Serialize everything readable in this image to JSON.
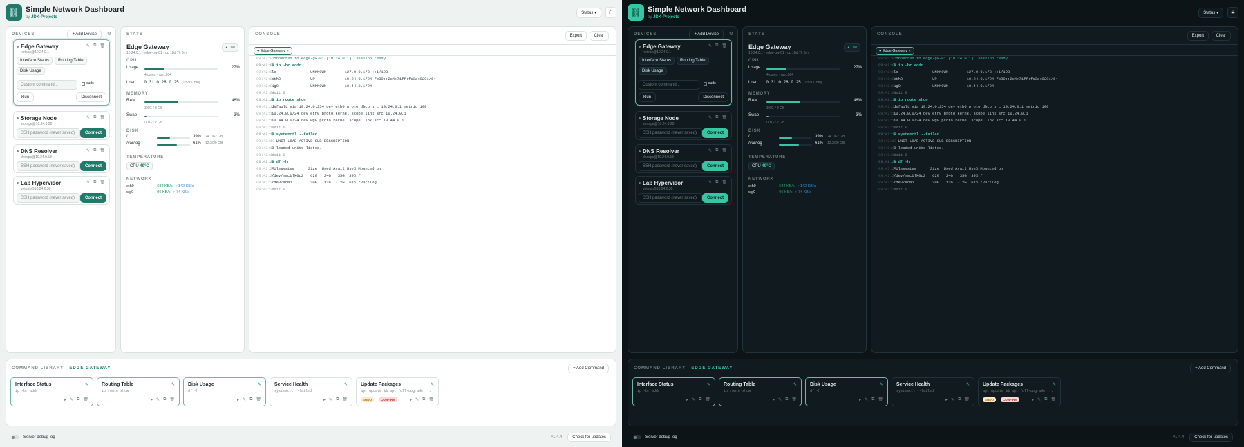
{
  "app": {
    "title": "Simple Network Dashboard",
    "by": "by",
    "author": "JDK-Projects",
    "status_label": "Status",
    "status_chevron": "▾",
    "theme_icons": [
      "moon-icon",
      "sun-icon"
    ]
  },
  "devices": {
    "title": "DEVICES",
    "add_label": "+ Add Device",
    "items": [
      {
        "name": "Edge Gateway",
        "sub": "netops@10.24.0.1",
        "selected": true
      },
      {
        "name": "Storage Node",
        "sub": "storage@10.24.0.20",
        "password_ph": "SSH password (never saved)",
        "connect": "Connect"
      },
      {
        "name": "DNS Resolver",
        "sub": "dnsops@10.24.0.53",
        "password_ph": "SSH password (never saved)",
        "connect": "Connect"
      },
      {
        "name": "Lab Hypervisor",
        "sub": "virtops@10.24.0.30",
        "password_ph": "SSH password (never saved)",
        "connect": "Connect"
      }
    ],
    "selected": {
      "quick": [
        "Interface Status",
        "Routing Table",
        "Disk Usage"
      ],
      "custom_ph": "Custom command...",
      "sudo": "sudo",
      "run": "Run",
      "disconnect": "Disconnect"
    }
  },
  "stats": {
    "title": "STATS",
    "device": "Edge Gateway",
    "live": "Live",
    "subline": "10.24.0.1 · edge-gw-01 · up 18d 7h 3m",
    "cpu_label": "CPU",
    "usage_label": "Usage",
    "usage": "27%",
    "usage_frac": 0.27,
    "cores": "4 cores · aarch64",
    "load_label": "Load",
    "load": "0.31  0.28  0.25",
    "load_note": "(1/5/15 min)",
    "mem_label": "MEMORY",
    "ram_label": "RAM",
    "ram": "46%",
    "ram_frac": 0.46,
    "ram_detail": "3.6G / 8 GB",
    "swap_label": "Swap",
    "swap": "3%",
    "swap_frac": 0.03,
    "swap_detail": "0.1G / 2 GB",
    "disk_label": "DISK",
    "disks": [
      {
        "mount": "/",
        "pct": "39%",
        "frac": 0.39,
        "size": "24.1/62 GB"
      },
      {
        "mount": "/var/log",
        "pct": "61%",
        "frac": 0.61,
        "size": "12.2/20 GB"
      }
    ],
    "temp_label": "TEMPERATURE",
    "cpu_temp_label": "CPU",
    "cpu_temp": "49°C",
    "net_label": "NETWORK",
    "nets": [
      {
        "iface": "eth0",
        "down": "↓ 684 KB/s",
        "up": "↑ 142 KB/s"
      },
      {
        "iface": "wg0",
        "down": "↓ 96 KB/s",
        "up": "↑ 74 KB/s"
      }
    ]
  },
  "console": {
    "title": "CONSOLE",
    "export": "Export",
    "clear": "Clear",
    "tab": "Edge Gateway",
    "lines": [
      {
        "ts": "09:42:01",
        "text": "Connected to edge-gw-01 [10.24.0.1], session ready",
        "kind": "ok"
      },
      {
        "ts": "09:42:08",
        "text": "$ ip -br addr",
        "kind": "cmd"
      },
      {
        "ts": "09:42:09",
        "text": "lo               UNKNOWN        127.0.0.1/8 ::1/128",
        "kind": ""
      },
      {
        "ts": "09:42:09",
        "text": "eth0             UP             10.24.0.1/24 fe80::2c4:71ff:fe3a:9201/64",
        "kind": ""
      },
      {
        "ts": "09:42:09",
        "text": "wg0              UNKNOWN        10.44.0.1/24",
        "kind": ""
      },
      {
        "ts": "09:42:09",
        "text": "exit 0",
        "kind": "dim"
      },
      {
        "ts": "09:42:12",
        "text": "$ ip route show",
        "kind": "cmd"
      },
      {
        "ts": "09:42:13",
        "text": "default via 10.24.0.254 dev eth0 proto dhcp src 10.24.0.1 metric 100",
        "kind": ""
      },
      {
        "ts": "09:42:13",
        "text": "10.24.0.0/24 dev eth0 proto kernel scope link src 10.24.0.1",
        "kind": ""
      },
      {
        "ts": "09:42:13",
        "text": "10.44.0.0/24 dev wg0 proto kernel scope link src 10.44.0.1",
        "kind": ""
      },
      {
        "ts": "09:42:13",
        "text": "exit 0",
        "kind": "dim"
      },
      {
        "ts": "09:42:18",
        "text": "$ systemctl --failed",
        "kind": "cmd"
      },
      {
        "ts": "09:42:19",
        "text": "  UNIT LOAD ACTIVE SUB DESCRIPTION",
        "kind": ""
      },
      {
        "ts": "09:42:19",
        "text": "0 loaded units listed.",
        "kind": ""
      },
      {
        "ts": "09:42:19",
        "text": "exit 0",
        "kind": "dim"
      },
      {
        "ts": "09:42:24",
        "text": "$ df -h",
        "kind": "cmd"
      },
      {
        "ts": "09:42:25",
        "text": "Filesystem      Size  Used Avail Use% Mounted on",
        "kind": ""
      },
      {
        "ts": "09:42:25",
        "text": "/dev/mmcblk0p2   62G   24G   35G  39% /",
        "kind": ""
      },
      {
        "ts": "09:42:25",
        "text": "/dev/sda1        20G   12G  7.2G  61% /var/log",
        "kind": ""
      },
      {
        "ts": "09:42:25",
        "text": "exit 0",
        "kind": "dim"
      }
    ]
  },
  "library": {
    "title": "COMMAND LIBRARY · ",
    "device": "EDGE GATEWAY",
    "add": "+ Add Command",
    "cards": [
      {
        "name": "Interface Status",
        "cmd": "ip -br addr",
        "sel": true,
        "tags": []
      },
      {
        "name": "Routing Table",
        "cmd": "ip route show",
        "sel": true,
        "tags": []
      },
      {
        "name": "Disk Usage",
        "cmd": "df -h",
        "sel": true,
        "tags": []
      },
      {
        "name": "Service Health",
        "cmd": "systemctl --failed",
        "sel": false,
        "tags": []
      },
      {
        "name": "Update Packages",
        "cmd": "apt update && apt full-upgrade ...",
        "sel": false,
        "tags": [
          "SUDO",
          "CONFIRM"
        ]
      }
    ]
  },
  "footer": {
    "debug": "Server debug log",
    "version": "v1.4.4",
    "check": "Check for updates"
  },
  "colors": {
    "accent_light": "#1f7a6a",
    "accent_dark": "#35c6a3",
    "up": "#2f8be0",
    "down": "#1f9a5e"
  }
}
